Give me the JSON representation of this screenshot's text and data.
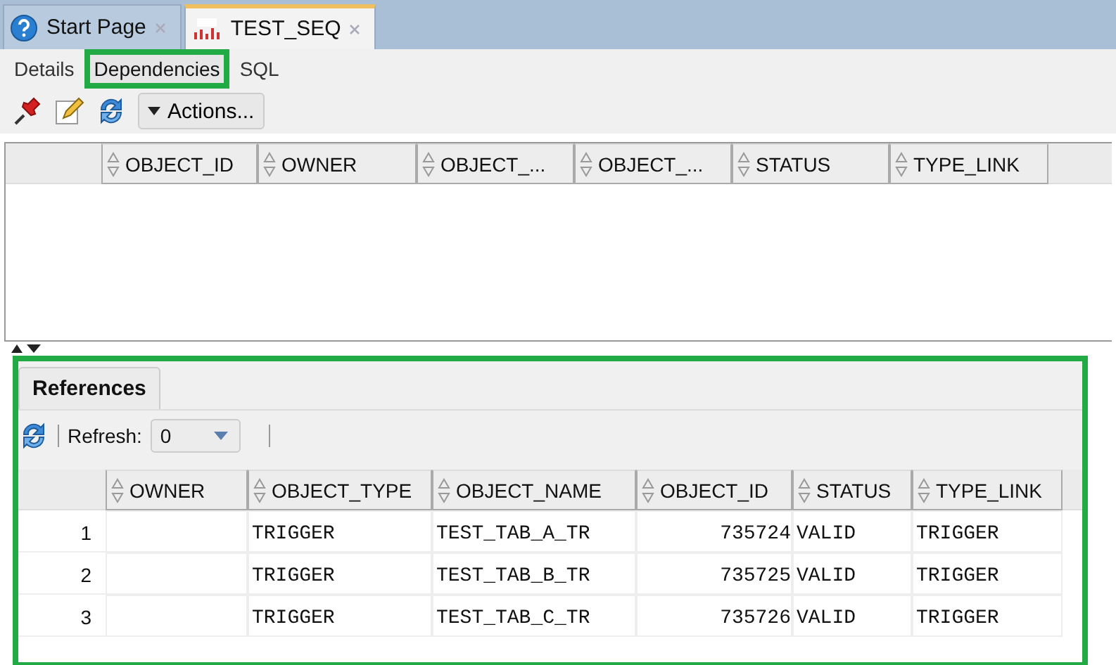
{
  "editor_tabs": [
    {
      "label": "Start Page",
      "selected": false
    },
    {
      "label": "TEST_SEQ",
      "selected": true
    }
  ],
  "sub_tabs": [
    {
      "label": "Details",
      "selected": false,
      "highlighted": false
    },
    {
      "label": "Dependencies",
      "selected": true,
      "highlighted": true
    },
    {
      "label": "SQL",
      "selected": false,
      "highlighted": false
    }
  ],
  "toolbar": {
    "actions_button": "Actions..."
  },
  "dependencies_table": {
    "columns": [
      "OBJECT_ID",
      "OWNER",
      "OBJECT_...",
      "OBJECT_...",
      "STATUS",
      "TYPE_LINK"
    ]
  },
  "references_panel": {
    "highlighted": true,
    "tab": "References",
    "refresh_label": "Refresh:",
    "refresh_value": "0",
    "columns": [
      "OWNER",
      "OBJECT_TYPE",
      "OBJECT_NAME",
      "OBJECT_ID",
      "STATUS",
      "TYPE_LINK"
    ],
    "rows": [
      {
        "number": "1",
        "cells": [
          "",
          "TRIGGER",
          "TEST_TAB_A_TR",
          "735724",
          "VALID",
          "TRIGGER"
        ]
      },
      {
        "number": "2",
        "cells": [
          "",
          "TRIGGER",
          "TEST_TAB_B_TR",
          "735725",
          "VALID",
          "TRIGGER"
        ]
      },
      {
        "number": "3",
        "cells": [
          "",
          "TRIGGER",
          "TEST_TAB_C_TR",
          "735726",
          "VALID",
          "TRIGGER"
        ]
      }
    ]
  }
}
